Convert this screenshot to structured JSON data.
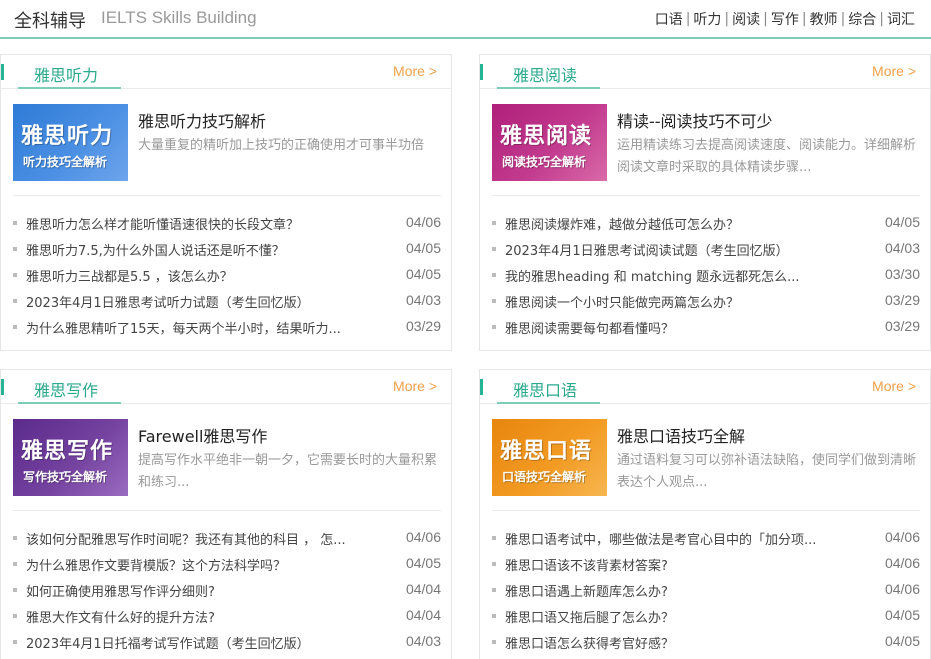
{
  "header": {
    "brand": "全科辅导",
    "subtitle": "IELTS Skills Building",
    "nav": [
      "口语",
      "听力",
      "阅读",
      "写作",
      "教师",
      "综合",
      "词汇"
    ]
  },
  "colors": {
    "accent": "#25b396",
    "more": "#f0a14a"
  },
  "panels": [
    {
      "title": "雅思听力",
      "more": "More >",
      "thumb": {
        "main": "雅思听力",
        "sub": "听力技巧全解析",
        "bg": "linear-gradient(135deg,#2f7bd6 0%,#4a8fe3 55%,#6ea4ec 100%)"
      },
      "feature_title": "雅思听力技巧解析",
      "feature_desc": "大量重复的精听加上技巧的正确使用才可事半功倍",
      "items": [
        {
          "text": "雅思听力怎么样才能听懂语速很快的长段文章？",
          "date": "04/06"
        },
        {
          "text": "雅思听力7.5,为什么外国人说话还是听不懂？",
          "date": "04/05"
        },
        {
          "text": "雅思听力三战都是5.5 ，该怎么办？",
          "date": "04/05"
        },
        {
          "text": "2023年4月1日雅思考试听力试题（考生回忆版）",
          "date": "04/03"
        },
        {
          "text": "为什么雅思精听了15天，每天两个半小时，结果听力...",
          "date": "03/29"
        }
      ]
    },
    {
      "title": "雅思阅读",
      "more": "More >",
      "thumb": {
        "main": "雅思阅读",
        "sub": "阅读技巧全解析",
        "bg": "linear-gradient(135deg,#b0207a 0%,#c23a8e 55%,#d96aa8 100%)"
      },
      "feature_title": "精读--阅读技巧不可少",
      "feature_desc": "运用精读练习去提高阅读速度、阅读能力。详细解析阅读文章时采取的具体精读步骤...",
      "items": [
        {
          "text": "雅思阅读爆炸难，越做分越低可怎么办？",
          "date": "04/05"
        },
        {
          "text": "2023年4月1日雅思考试阅读试题（考生回忆版）",
          "date": "04/03"
        },
        {
          "text": "我的雅思heading 和 matching 题永远都死怎么...",
          "date": "03/30"
        },
        {
          "text": "雅思阅读一个小时只能做完两篇怎么办？",
          "date": "03/29"
        },
        {
          "text": "雅思阅读需要每句都看懂吗？",
          "date": "03/29"
        }
      ]
    },
    {
      "title": "雅思写作",
      "more": "More >",
      "thumb": {
        "main": "雅思写作",
        "sub": "写作技巧全解析",
        "bg": "linear-gradient(135deg,#5b2b8c 0%,#74429f 55%,#9a6cc0 100%)"
      },
      "feature_title": "Farewell雅思写作",
      "feature_desc": "提高写作水平绝非一朝一夕，它需要长时的大量积累和练习...",
      "items": [
        {
          "text": "该如何分配雅思写作时间呢？我还有其他的科目 ， 怎...",
          "date": "04/06"
        },
        {
          "text": "为什么雅思作文要背模版？这个方法科学吗？",
          "date": "04/05"
        },
        {
          "text": "如何正确使用雅思写作评分细则?",
          "date": "04/04"
        },
        {
          "text": "雅思大作文有什么好的提升方法?",
          "date": "04/04"
        },
        {
          "text": "2023年4月1日托福考试写作试题（考生回忆版）",
          "date": "04/03"
        }
      ]
    },
    {
      "title": "雅思口语",
      "more": "More >",
      "thumb": {
        "main": "雅思口语",
        "sub": "口语技巧全解析",
        "bg": "linear-gradient(135deg,#e8860f 0%,#f29a22 55%,#f7b650 100%)"
      },
      "feature_title": "雅思口语技巧全解",
      "feature_desc": "通过语料复习可以弥补语法缺陷，使同学们做到清晰表达个人观点...",
      "items": [
        {
          "text": "雅思口语考试中，哪些做法是考官心目中的「加分项...",
          "date": "04/06"
        },
        {
          "text": "雅思口语该不该背素材答案?",
          "date": "04/06"
        },
        {
          "text": "雅思口语遇上新题库怎么办?",
          "date": "04/06"
        },
        {
          "text": "雅思口语又拖后腿了怎么办？",
          "date": "04/05"
        },
        {
          "text": "雅思口语怎么获得考官好感？",
          "date": "04/05"
        }
      ]
    }
  ]
}
